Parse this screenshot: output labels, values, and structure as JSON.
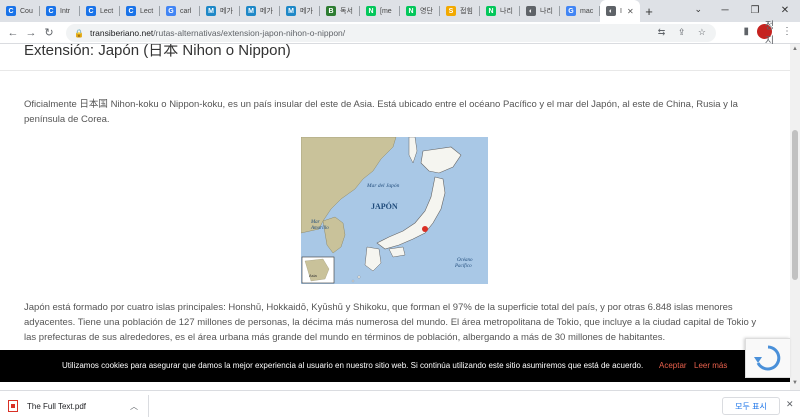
{
  "tabs": [
    {
      "label": "Cou",
      "icon": "c-icon",
      "color": "#1a73e8",
      "glyph": "C"
    },
    {
      "label": "Intr",
      "icon": "c-icon",
      "color": "#1a73e8",
      "glyph": "C"
    },
    {
      "label": "Lect",
      "icon": "c-icon",
      "color": "#1a73e8",
      "glyph": "C"
    },
    {
      "label": "Lect",
      "icon": "c-icon",
      "color": "#1a73e8",
      "glyph": "C"
    },
    {
      "label": "carl",
      "icon": "google-icon",
      "color": "#4285f4",
      "glyph": "G"
    },
    {
      "label": "메가",
      "icon": "megastudy-icon",
      "color": "#1e88c7",
      "glyph": "M"
    },
    {
      "label": "메가",
      "icon": "megastudy-icon",
      "color": "#1e88c7",
      "glyph": "M"
    },
    {
      "label": "메가",
      "icon": "megastudy-icon",
      "color": "#1e88c7",
      "glyph": "M"
    },
    {
      "label": "독서",
      "icon": "book-icon",
      "color": "#2e7d32",
      "glyph": "B"
    },
    {
      "label": "[me",
      "icon": "naver-icon",
      "color": "#03c75a",
      "glyph": "N"
    },
    {
      "label": "영단",
      "icon": "naver-icon",
      "color": "#03c75a",
      "glyph": "N"
    },
    {
      "label": "접힘",
      "icon": "s-icon",
      "color": "#f2a900",
      "glyph": "S"
    },
    {
      "label": "나리",
      "icon": "naver-icon",
      "color": "#03c75a",
      "glyph": "N"
    },
    {
      "label": "나리",
      "icon": "globe-icon",
      "color": "#5f6368",
      "glyph": "◐"
    },
    {
      "label": "mac",
      "icon": "google-icon",
      "color": "#4285f4",
      "glyph": "G"
    }
  ],
  "active_tab": {
    "label": "I",
    "icon": "globe-icon",
    "color": "#5f6368",
    "glyph": "◐"
  },
  "address_bar": {
    "host": "transiberiano.net",
    "path": "/rutas-alternativas/extension-japon-nihon-o-nippon/"
  },
  "profile_label": "정지",
  "page": {
    "heading": "Extensión: Japón (日本 Nihon o Nippon)",
    "paragraph1": "Oficialmente 日本国 Nihon-koku o Nippon-koku, es un país insular del este de Asia. Está ubicado entre el océano Pacífico y el mar del Japón, al este de China, Rusia y la península de Corea.",
    "paragraph2": "Japón está formado por cuatro islas principales: Honshū, Hokkaidō, Kyūshū y Shikoku, que forman el 97% de la superficie total del país, y por otras 6.848 islas menores adyacentes. Tiene una población de 127 millones de personas, la décima más numerosa del mundo. El área metropolitana de Tokio, que incluye a la ciudad capital de Tokio y las prefecturas de sus alrededores, es el área urbana más grande del mundo en términos de población, albergando a más de 30 millones de habitantes."
  },
  "map": {
    "label_sea": "Mar del Japón",
    "label_country": "JAPÓN",
    "label_amarillo_1": "Mar",
    "label_amarillo_2": "Amarillo",
    "label_ocean_1": "Océano",
    "label_ocean_2": "Pacífico",
    "label_inset": "Asia",
    "colors": {
      "water": "#a9c8e6",
      "land_asia": "#c9c29a",
      "land_japan": "#f5f5f0"
    }
  },
  "cookie_banner": {
    "message": "Utilizamos cookies para asegurar que damos la mejor experiencia al usuario en nuestro sitio web. Si continúa utilizando este sitio asumiremos que está de acuerdo.",
    "accept": "Aceptar",
    "more": "Leer más",
    "close": "×"
  },
  "downloads": {
    "file_name": "The Full Text.pdf",
    "show_all": "모두 표시"
  }
}
